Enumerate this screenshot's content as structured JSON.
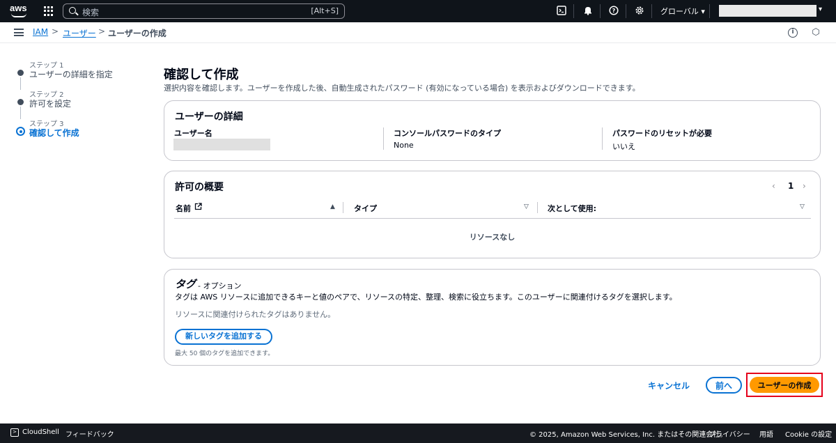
{
  "topnav": {
    "logo": "aws",
    "search_placeholder": "検索",
    "search_shortcut": "[Alt+S]",
    "region": "グローバル ▾",
    "icons": [
      "cloudshell-icon",
      "bell-icon",
      "help-icon",
      "settings-icon"
    ]
  },
  "breadcrumb": {
    "items": [
      "IAM",
      "ユーザー",
      "ユーザーの作成"
    ],
    "separator": ">"
  },
  "steps": [
    {
      "num": "ステップ 1",
      "title": "ユーザーの詳細を指定"
    },
    {
      "num": "ステップ 2",
      "title": "許可を設定"
    },
    {
      "num": "ステップ 3",
      "title": "確認して作成"
    }
  ],
  "main": {
    "title": "確認して作成",
    "description": "選択内容を確認します。ユーザーを作成した後、自動生成されたパスワード (有効になっている場合) を表示およびダウンロードできます。"
  },
  "user_details": {
    "title": "ユーザーの詳細",
    "fields": [
      {
        "label": "ユーザー名",
        "value": ""
      },
      {
        "label": "コンソールパスワードのタイプ",
        "value": "None"
      },
      {
        "label": "パスワードのリセットが必要",
        "value": "いいえ"
      }
    ]
  },
  "permissions": {
    "title": "許可の概要",
    "page": "1",
    "prev": "‹",
    "next": "›",
    "columns": [
      "名前",
      "タイプ",
      "次として使用:"
    ],
    "empty": "リソースなし"
  },
  "tags": {
    "title": "タグ",
    "optional": "- オプション",
    "description": "タグは AWS リソースに追加できるキーと値のペアで、リソースの特定、整理、検索に役立ちます。このユーザーに関連付けるタグを選択します。",
    "none": "リソースに関連付けられたタグはありません。",
    "add_button": "新しいタグを追加する",
    "limit": "最大 50 個のタグを追加できます。"
  },
  "actions": {
    "cancel": "キャンセル",
    "previous": "前へ",
    "create": "ユーザーの作成"
  },
  "footer": {
    "cloudshell": "CloudShell",
    "feedback": "フィードバック",
    "copyright": "© 2025, Amazon Web Services, Inc. またはその関連会社。",
    "privacy": "プライバシー",
    "terms": "用語",
    "cookie": "Cookie の設定"
  },
  "colors": {
    "accent": "#0972d3",
    "primary_button": "#ff9900",
    "highlight_border": "#e5001a",
    "nav_bg": "#0f141a"
  }
}
